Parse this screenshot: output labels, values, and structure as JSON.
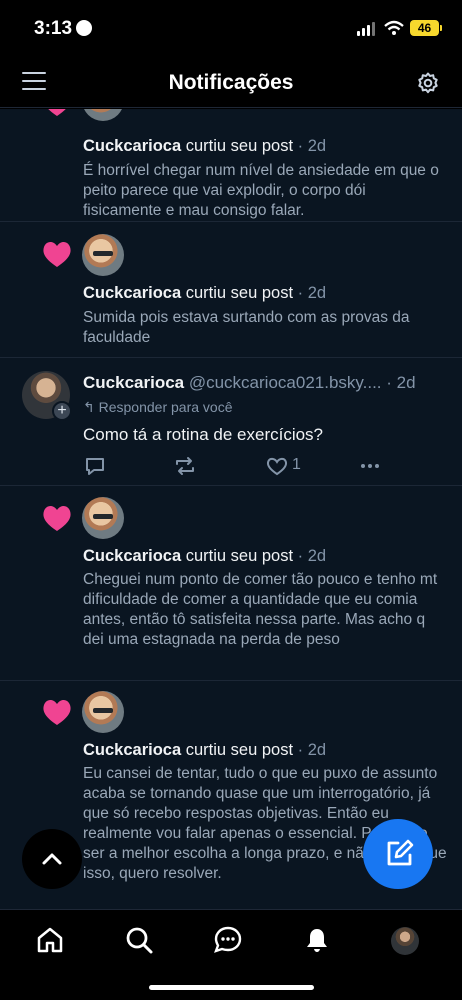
{
  "status": {
    "time": "3:13",
    "battery": "46"
  },
  "header": {
    "title": "Notificações"
  },
  "notifications": [
    {
      "user": "Cuckcarioca",
      "action": " curtiu seu post",
      "age": " · 2d",
      "text": "É horrível chegar num nível de ansiedade em que o peito parece que vai explodir, o corpo dói fisicamente e mau consigo falar."
    },
    {
      "user": "Cuckcarioca",
      "action": " curtiu seu post",
      "age": " · 2d",
      "text": "Sumida pois estava surtando com as provas da faculdade"
    },
    {
      "user": "Cuckcarioca",
      "action": " curtiu seu post",
      "age": " · 2d",
      "text": "Cheguei num ponto de comer tão pouco e tenho mt dificuldade de comer a quantidade que eu comia antes, então tô satisfeita nessa parte. Mas acho q dei uma estagnada na perda de peso"
    },
    {
      "user": "Cuckcarioca",
      "action": " curtiu seu post",
      "age": " · 2d",
      "text": "Eu cansei de tentar, tudo o que eu puxo de assunto acaba se tornando quase que um interrogatório, já que só recebo respostas objetivas. Então eu realmente vou falar apenas o essencial. Pode não ser a melhor escolha a longa prazo, e não quero que isso, quero resolver."
    }
  ],
  "reply": {
    "user": "Cuckcarioca",
    "handle": " @cuckcarioca021.bsky....",
    "age": " · 2d",
    "note": "↰ Responder para você",
    "text": "Como tá a rotina de exercícios?",
    "likes": "1"
  },
  "icons": [
    "menu-icon",
    "settings-gear-icon",
    "heart-icon",
    "comment-icon",
    "repost-icon",
    "like-icon",
    "more-icon",
    "home-icon",
    "search-icon",
    "chat-icon",
    "notifications-bell-icon",
    "chevron-up-icon",
    "compose-icon"
  ],
  "colors": {
    "background": "#0a1521",
    "accent": "#1877f2",
    "heart": "#f04492"
  }
}
